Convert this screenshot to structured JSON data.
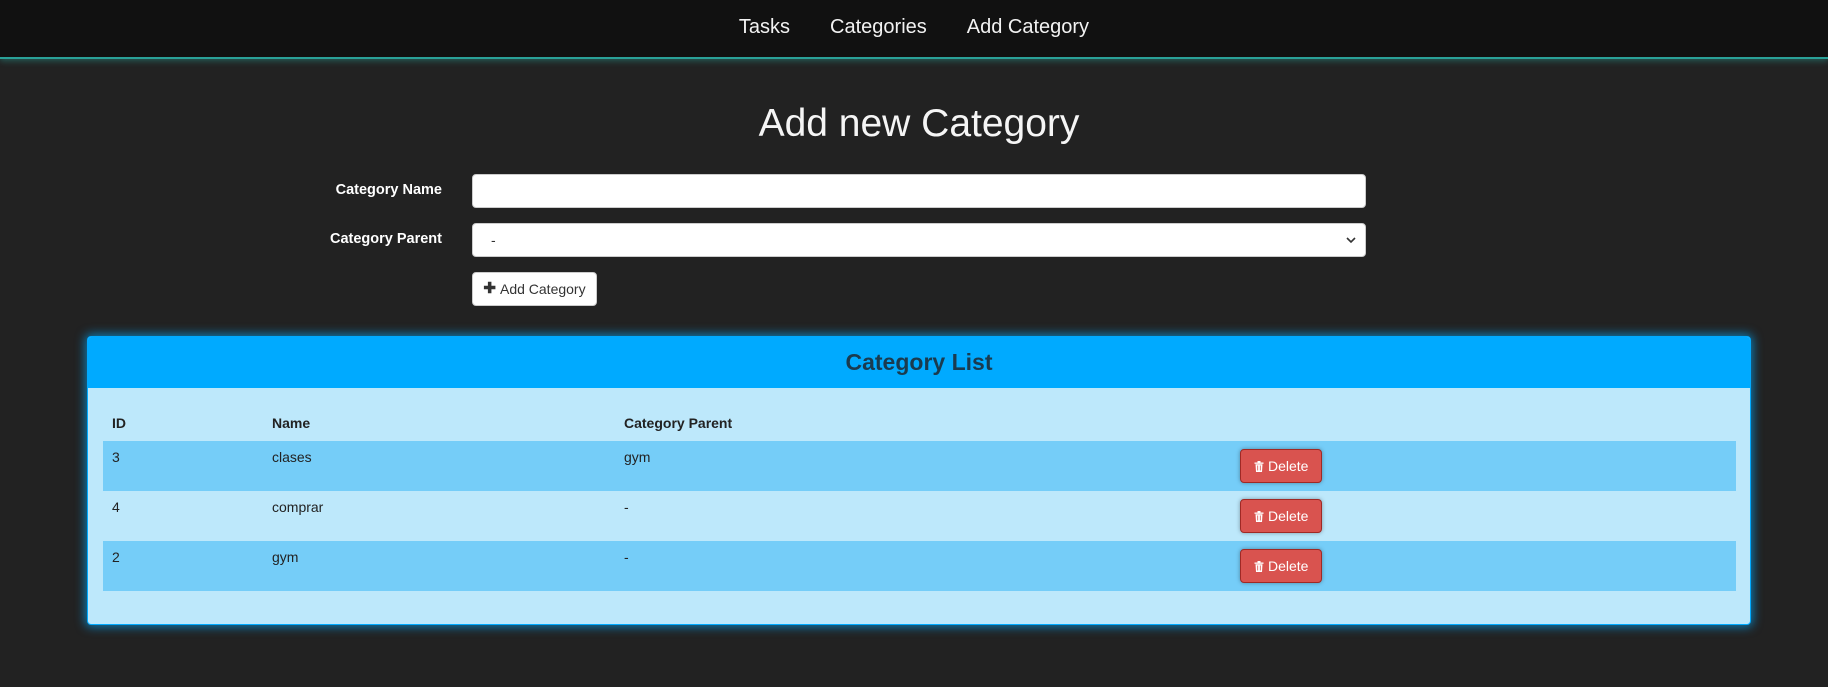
{
  "nav": {
    "items": [
      {
        "label": "Tasks"
      },
      {
        "label": "Categories"
      },
      {
        "label": "Add Category"
      }
    ]
  },
  "page": {
    "title": "Add new Category"
  },
  "form": {
    "name_label": "Category Name",
    "name_value": "",
    "parent_label": "Category Parent",
    "parent_selected": "-",
    "add_button_label": "Add Category"
  },
  "panel": {
    "title": "Category List",
    "columns": [
      "ID",
      "Name",
      "Category Parent"
    ],
    "rows": [
      {
        "id": "3",
        "name": "clases",
        "parent": "gym",
        "action": "Delete"
      },
      {
        "id": "4",
        "name": "comprar",
        "parent": "-",
        "action": "Delete"
      },
      {
        "id": "2",
        "name": "gym",
        "parent": "-",
        "action": "Delete"
      }
    ]
  },
  "colors": {
    "background": "#222222",
    "navbar": "#111111",
    "navbar_accent": "#2aa198",
    "panel_heading": "#00aaff",
    "panel_body": "#bde8fb",
    "row_stripe": "#75cdf8",
    "delete_button": "#d9534f"
  },
  "icons": {
    "add_button": "plus-icon",
    "delete_button": "trash-icon",
    "select": "chevron-down-icon"
  }
}
